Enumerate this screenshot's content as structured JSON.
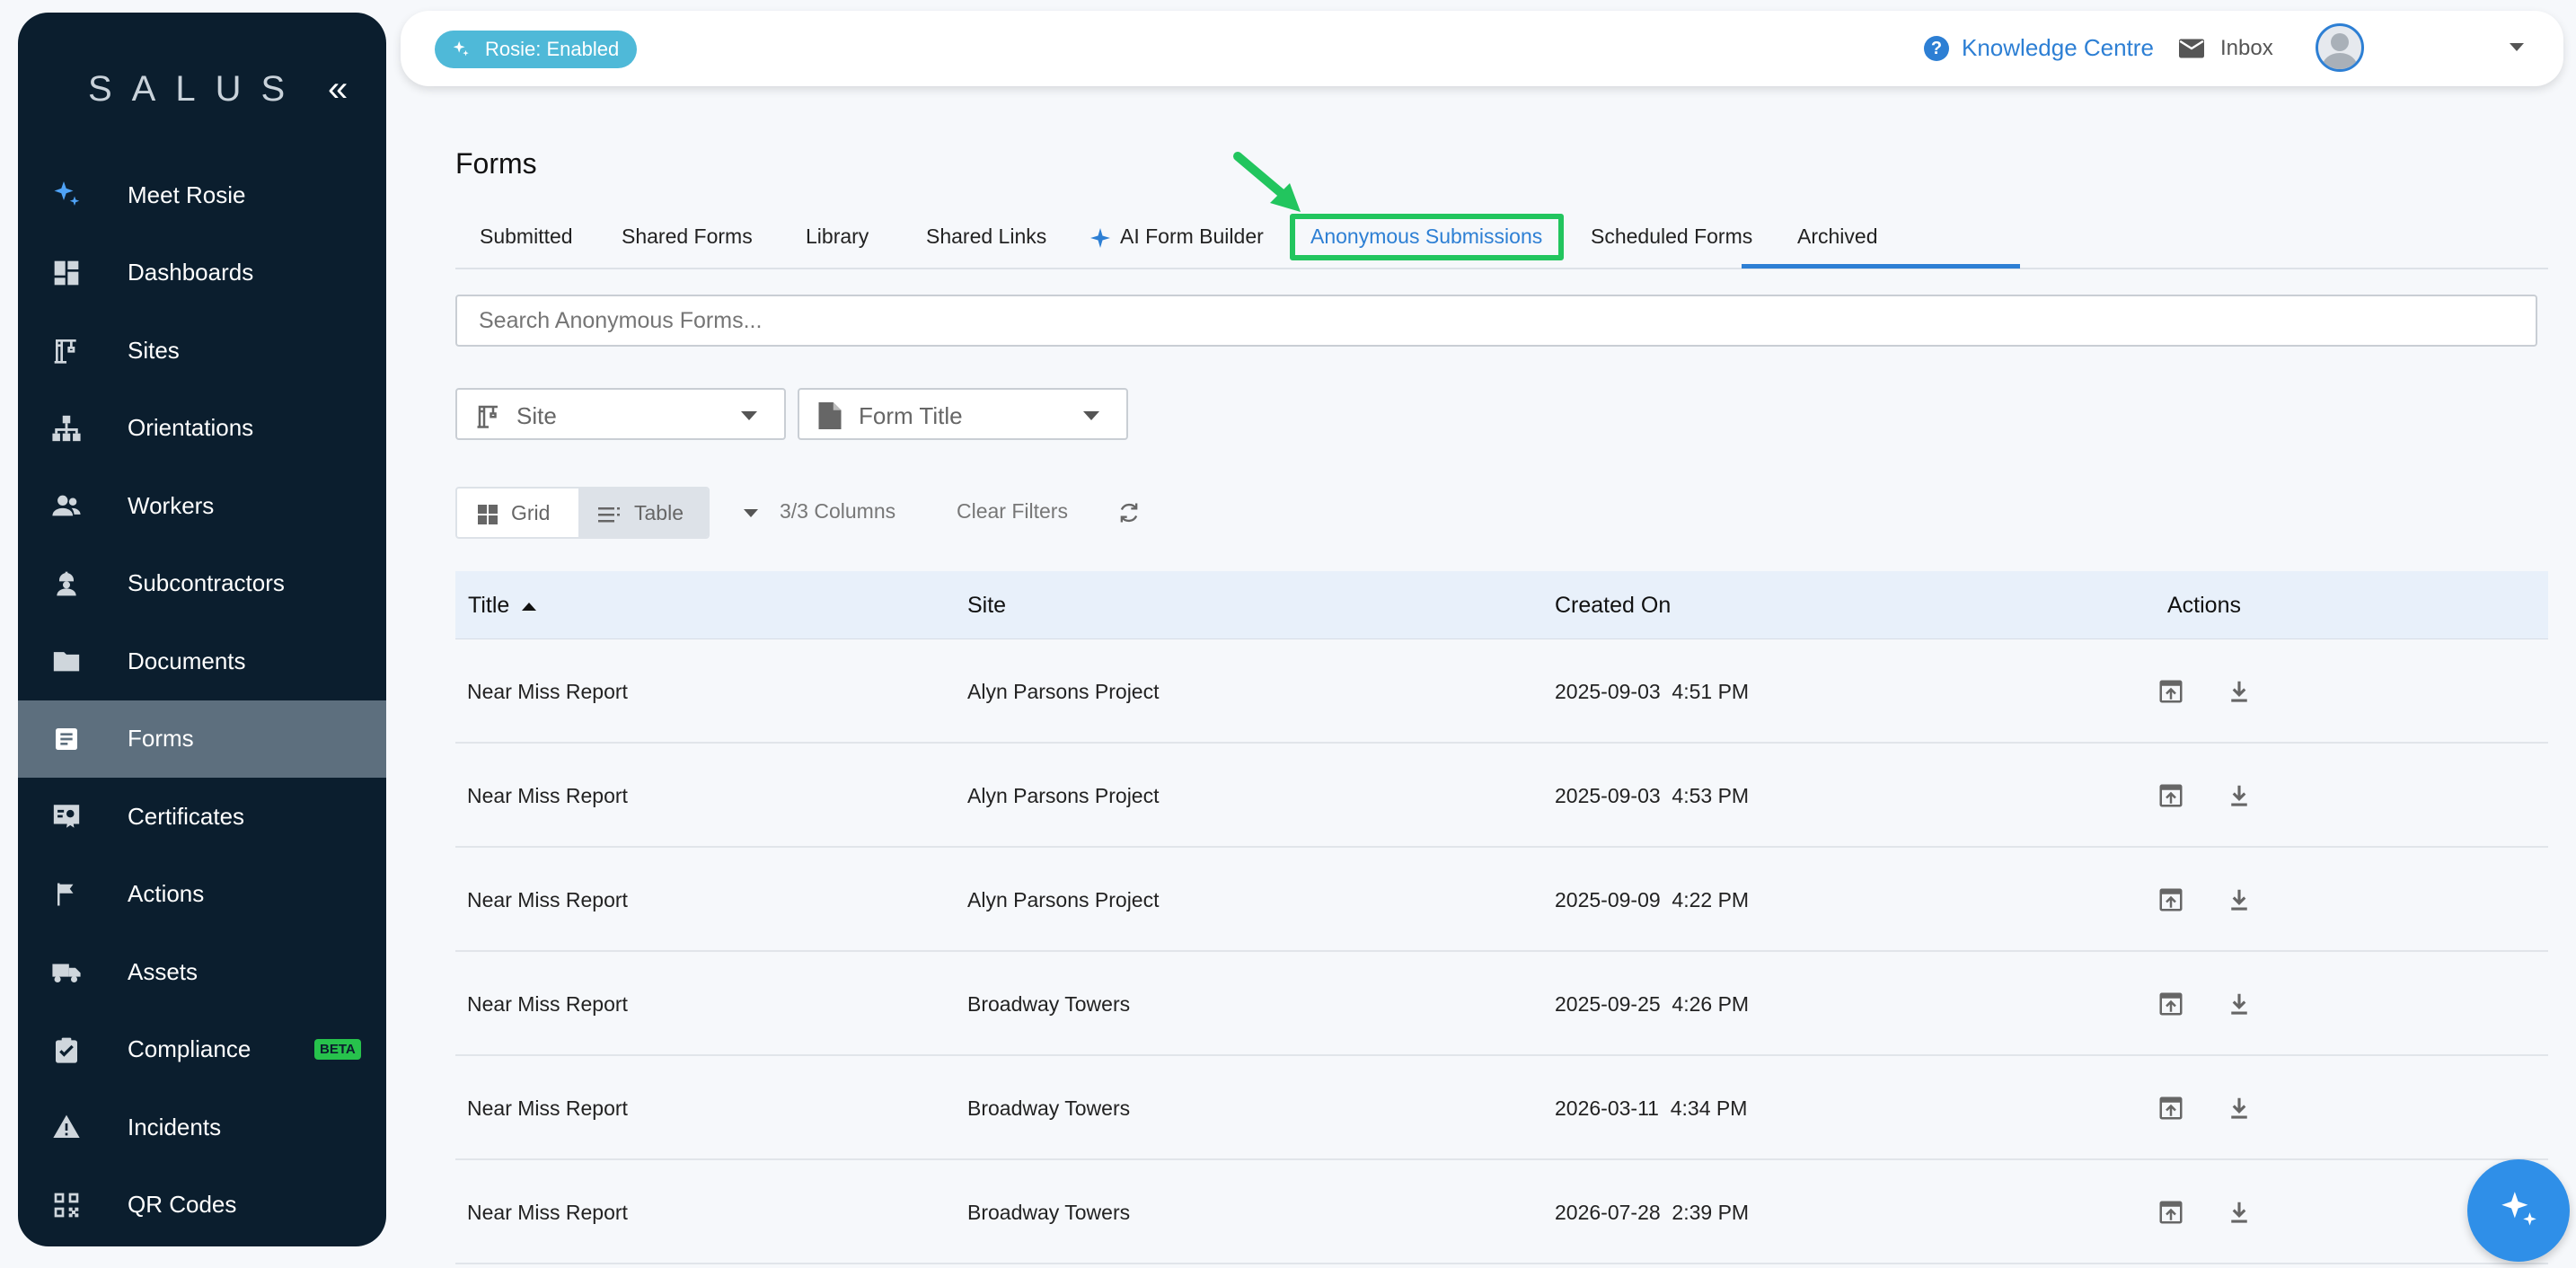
{
  "sidebar": {
    "logo": "SALUS",
    "collapse_glyph": "«",
    "items": [
      {
        "label": "Meet Rosie",
        "icon": "sparkle-icon"
      },
      {
        "label": "Dashboards",
        "icon": "dashboard-icon"
      },
      {
        "label": "Sites",
        "icon": "crane-icon"
      },
      {
        "label": "Orientations",
        "icon": "org-chart-icon"
      },
      {
        "label": "Workers",
        "icon": "people-icon"
      },
      {
        "label": "Subcontractors",
        "icon": "worker-helmet-icon"
      },
      {
        "label": "Documents",
        "icon": "folder-icon"
      },
      {
        "label": "Forms",
        "icon": "form-icon",
        "active": true
      },
      {
        "label": "Certificates",
        "icon": "certificate-icon"
      },
      {
        "label": "Actions",
        "icon": "flag-icon"
      },
      {
        "label": "Assets",
        "icon": "truck-icon"
      },
      {
        "label": "Compliance",
        "icon": "clipboard-check-icon",
        "badge": "BETA"
      },
      {
        "label": "Incidents",
        "icon": "warning-icon"
      },
      {
        "label": "QR Codes",
        "icon": "qr-code-icon"
      }
    ]
  },
  "topbar": {
    "rosie_chip": "Rosie: Enabled",
    "knowledge_centre": "Knowledge Centre",
    "inbox": "Inbox"
  },
  "page": {
    "title": "Forms",
    "tabs": [
      {
        "label": "Submitted"
      },
      {
        "label": "Shared Forms"
      },
      {
        "label": "Library"
      },
      {
        "label": "Shared Links"
      },
      {
        "label": "AI Form Builder"
      },
      {
        "label": "Anonymous Submissions",
        "active": true
      },
      {
        "label": "Scheduled Forms"
      },
      {
        "label": "Archived"
      }
    ],
    "search_placeholder": "Search Anonymous Forms...",
    "filters": {
      "site": "Site",
      "form_title": "Form Title"
    },
    "view": {
      "grid": "Grid",
      "table": "Table",
      "active": "Table"
    },
    "columns_label": "3/3 Columns",
    "clear_filters": "Clear Filters"
  },
  "table": {
    "headers": {
      "title": "Title",
      "site": "Site",
      "created_on": "Created On",
      "actions": "Actions"
    },
    "rows": [
      {
        "title": "Near Miss Report",
        "site": "Alyn Parsons Project",
        "created_on": "2025-09-03  4:51 PM"
      },
      {
        "title": "Near Miss Report",
        "site": "Alyn Parsons Project",
        "created_on": "2025-09-03  4:53 PM"
      },
      {
        "title": "Near Miss Report",
        "site": "Alyn Parsons Project",
        "created_on": "2025-09-09  4:22 PM"
      },
      {
        "title": "Near Miss Report",
        "site": "Broadway Towers",
        "created_on": "2025-09-25  4:26 PM"
      },
      {
        "title": "Near Miss Report",
        "site": "Broadway Towers",
        "created_on": "2026-03-11  4:34 PM"
      },
      {
        "title": "Near Miss Report",
        "site": "Broadway Towers",
        "created_on": "2026-07-28  2:39 PM"
      }
    ]
  },
  "colors": {
    "sidebar_bg": "#0b1e2e",
    "accent": "#2d7fd4",
    "highlight": "#22c55e",
    "rosie": "#4fb9d8"
  }
}
